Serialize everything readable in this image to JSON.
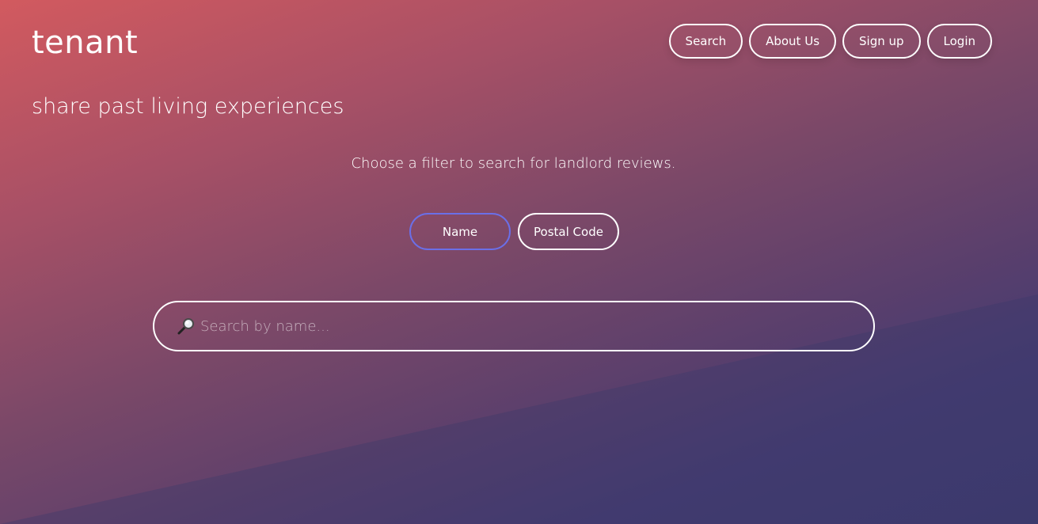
{
  "header": {
    "logo": "tenant",
    "nav": [
      {
        "label": "Search"
      },
      {
        "label": "About Us"
      },
      {
        "label": "Sign up"
      },
      {
        "label": "Login"
      }
    ]
  },
  "hero": {
    "tagline": "share past living experiences",
    "instruction": "Choose a filter to search for landlord reviews."
  },
  "filters": {
    "options": [
      {
        "label": "Name",
        "active": true
      },
      {
        "label": "Postal Code",
        "active": false
      }
    ],
    "active_border_color": "#6b6fe8"
  },
  "search": {
    "icon": "magnifying-glass-icon",
    "placeholder": "Search by name...",
    "value": ""
  }
}
